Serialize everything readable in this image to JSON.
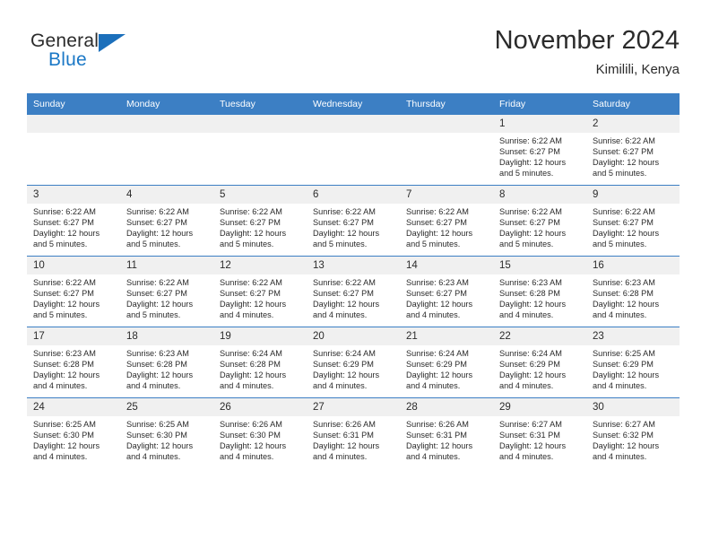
{
  "brand": {
    "name_part1": "General",
    "name_part2": "Blue",
    "triangle_color": "#1b6fbb",
    "blue_color": "#1b78c6"
  },
  "header": {
    "title": "November 2024",
    "subtitle": "Kimilili, Kenya"
  },
  "theme": {
    "header_bg": "#3c7fc4",
    "daynum_bg": "#f0f0f0",
    "text": "#2b2b2b"
  },
  "weekdays": [
    "Sunday",
    "Monday",
    "Tuesday",
    "Wednesday",
    "Thursday",
    "Friday",
    "Saturday"
  ],
  "labels": {
    "sunrise": "Sunrise:",
    "sunset": "Sunset:",
    "daylight": "Daylight:"
  },
  "weeks": [
    [
      {
        "day": "",
        "empty": true
      },
      {
        "day": "",
        "empty": true
      },
      {
        "day": "",
        "empty": true
      },
      {
        "day": "",
        "empty": true
      },
      {
        "day": "",
        "empty": true
      },
      {
        "day": "1",
        "sunrise": "Sunrise: 6:22 AM",
        "sunset": "Sunset: 6:27 PM",
        "daylight": "Daylight: 12 hours and 5 minutes."
      },
      {
        "day": "2",
        "sunrise": "Sunrise: 6:22 AM",
        "sunset": "Sunset: 6:27 PM",
        "daylight": "Daylight: 12 hours and 5 minutes."
      }
    ],
    [
      {
        "day": "3",
        "sunrise": "Sunrise: 6:22 AM",
        "sunset": "Sunset: 6:27 PM",
        "daylight": "Daylight: 12 hours and 5 minutes."
      },
      {
        "day": "4",
        "sunrise": "Sunrise: 6:22 AM",
        "sunset": "Sunset: 6:27 PM",
        "daylight": "Daylight: 12 hours and 5 minutes."
      },
      {
        "day": "5",
        "sunrise": "Sunrise: 6:22 AM",
        "sunset": "Sunset: 6:27 PM",
        "daylight": "Daylight: 12 hours and 5 minutes."
      },
      {
        "day": "6",
        "sunrise": "Sunrise: 6:22 AM",
        "sunset": "Sunset: 6:27 PM",
        "daylight": "Daylight: 12 hours and 5 minutes."
      },
      {
        "day": "7",
        "sunrise": "Sunrise: 6:22 AM",
        "sunset": "Sunset: 6:27 PM",
        "daylight": "Daylight: 12 hours and 5 minutes."
      },
      {
        "day": "8",
        "sunrise": "Sunrise: 6:22 AM",
        "sunset": "Sunset: 6:27 PM",
        "daylight": "Daylight: 12 hours and 5 minutes."
      },
      {
        "day": "9",
        "sunrise": "Sunrise: 6:22 AM",
        "sunset": "Sunset: 6:27 PM",
        "daylight": "Daylight: 12 hours and 5 minutes."
      }
    ],
    [
      {
        "day": "10",
        "sunrise": "Sunrise: 6:22 AM",
        "sunset": "Sunset: 6:27 PM",
        "daylight": "Daylight: 12 hours and 5 minutes."
      },
      {
        "day": "11",
        "sunrise": "Sunrise: 6:22 AM",
        "sunset": "Sunset: 6:27 PM",
        "daylight": "Daylight: 12 hours and 5 minutes."
      },
      {
        "day": "12",
        "sunrise": "Sunrise: 6:22 AM",
        "sunset": "Sunset: 6:27 PM",
        "daylight": "Daylight: 12 hours and 4 minutes."
      },
      {
        "day": "13",
        "sunrise": "Sunrise: 6:22 AM",
        "sunset": "Sunset: 6:27 PM",
        "daylight": "Daylight: 12 hours and 4 minutes."
      },
      {
        "day": "14",
        "sunrise": "Sunrise: 6:23 AM",
        "sunset": "Sunset: 6:27 PM",
        "daylight": "Daylight: 12 hours and 4 minutes."
      },
      {
        "day": "15",
        "sunrise": "Sunrise: 6:23 AM",
        "sunset": "Sunset: 6:28 PM",
        "daylight": "Daylight: 12 hours and 4 minutes."
      },
      {
        "day": "16",
        "sunrise": "Sunrise: 6:23 AM",
        "sunset": "Sunset: 6:28 PM",
        "daylight": "Daylight: 12 hours and 4 minutes."
      }
    ],
    [
      {
        "day": "17",
        "sunrise": "Sunrise: 6:23 AM",
        "sunset": "Sunset: 6:28 PM",
        "daylight": "Daylight: 12 hours and 4 minutes."
      },
      {
        "day": "18",
        "sunrise": "Sunrise: 6:23 AM",
        "sunset": "Sunset: 6:28 PM",
        "daylight": "Daylight: 12 hours and 4 minutes."
      },
      {
        "day": "19",
        "sunrise": "Sunrise: 6:24 AM",
        "sunset": "Sunset: 6:28 PM",
        "daylight": "Daylight: 12 hours and 4 minutes."
      },
      {
        "day": "20",
        "sunrise": "Sunrise: 6:24 AM",
        "sunset": "Sunset: 6:29 PM",
        "daylight": "Daylight: 12 hours and 4 minutes."
      },
      {
        "day": "21",
        "sunrise": "Sunrise: 6:24 AM",
        "sunset": "Sunset: 6:29 PM",
        "daylight": "Daylight: 12 hours and 4 minutes."
      },
      {
        "day": "22",
        "sunrise": "Sunrise: 6:24 AM",
        "sunset": "Sunset: 6:29 PM",
        "daylight": "Daylight: 12 hours and 4 minutes."
      },
      {
        "day": "23",
        "sunrise": "Sunrise: 6:25 AM",
        "sunset": "Sunset: 6:29 PM",
        "daylight": "Daylight: 12 hours and 4 minutes."
      }
    ],
    [
      {
        "day": "24",
        "sunrise": "Sunrise: 6:25 AM",
        "sunset": "Sunset: 6:30 PM",
        "daylight": "Daylight: 12 hours and 4 minutes."
      },
      {
        "day": "25",
        "sunrise": "Sunrise: 6:25 AM",
        "sunset": "Sunset: 6:30 PM",
        "daylight": "Daylight: 12 hours and 4 minutes."
      },
      {
        "day": "26",
        "sunrise": "Sunrise: 6:26 AM",
        "sunset": "Sunset: 6:30 PM",
        "daylight": "Daylight: 12 hours and 4 minutes."
      },
      {
        "day": "27",
        "sunrise": "Sunrise: 6:26 AM",
        "sunset": "Sunset: 6:31 PM",
        "daylight": "Daylight: 12 hours and 4 minutes."
      },
      {
        "day": "28",
        "sunrise": "Sunrise: 6:26 AM",
        "sunset": "Sunset: 6:31 PM",
        "daylight": "Daylight: 12 hours and 4 minutes."
      },
      {
        "day": "29",
        "sunrise": "Sunrise: 6:27 AM",
        "sunset": "Sunset: 6:31 PM",
        "daylight": "Daylight: 12 hours and 4 minutes."
      },
      {
        "day": "30",
        "sunrise": "Sunrise: 6:27 AM",
        "sunset": "Sunset: 6:32 PM",
        "daylight": "Daylight: 12 hours and 4 minutes."
      }
    ]
  ]
}
